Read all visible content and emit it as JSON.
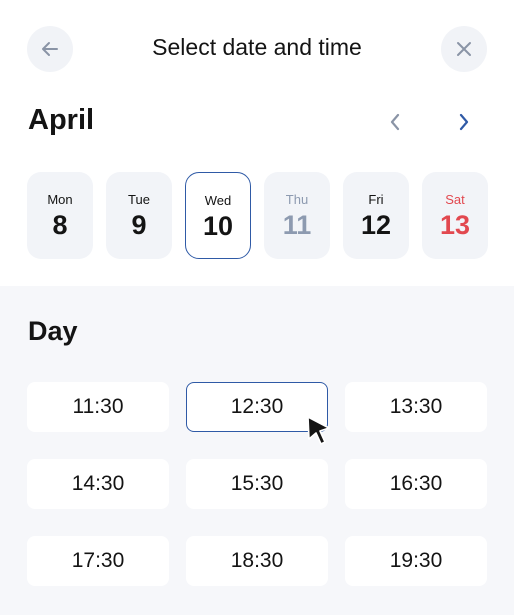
{
  "header": {
    "title": "Select date and time"
  },
  "calendar": {
    "month": "April",
    "days": [
      {
        "name": "Mon",
        "number": "8"
      },
      {
        "name": "Tue",
        "number": "9"
      },
      {
        "name": "Wed",
        "number": "10"
      },
      {
        "name": "Thu",
        "number": "11"
      },
      {
        "name": "Fri",
        "number": "12"
      },
      {
        "name": "Sat",
        "number": "13"
      }
    ],
    "selected_day": "10"
  },
  "times": {
    "title": "Day",
    "slots": [
      "11:30",
      "12:30",
      "13:30",
      "14:30",
      "15:30",
      "16:30",
      "17:30",
      "18:30",
      "19:30"
    ],
    "selected": "12:30"
  },
  "colors": {
    "accent": "#2f5aa6",
    "weekend": "#e2484f",
    "muted": "#8d9ab0",
    "card_bg": "#f2f4f8",
    "section_bg": "#f6f7fa"
  },
  "icons": {
    "back": "arrow-left-icon",
    "close": "close-icon",
    "prev": "chevron-left-icon",
    "next": "chevron-right-icon",
    "cursor": "mouse-pointer-icon"
  }
}
